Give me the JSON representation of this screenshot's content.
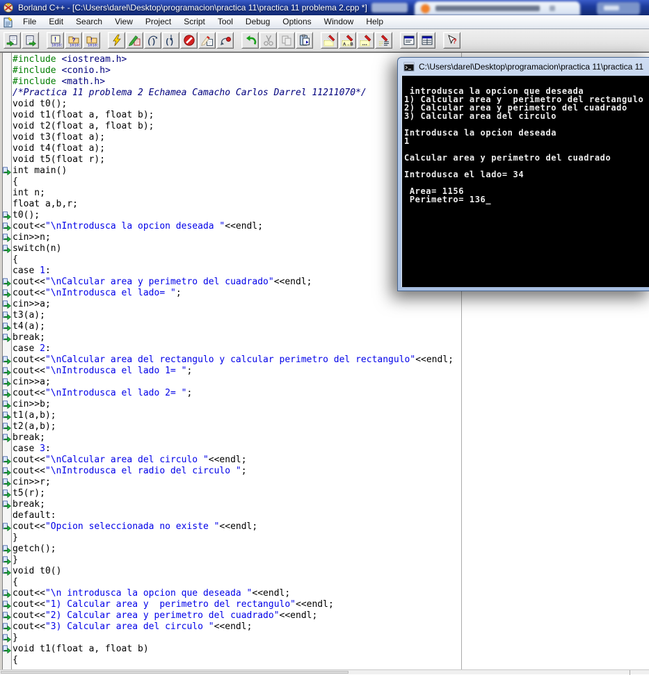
{
  "window": {
    "title": "Borland C++ - [C:\\Users\\darel\\Desktop\\programacion\\practica 11\\practica 11 problema 2.cpp *]"
  },
  "menu": {
    "items": [
      "File",
      "Edit",
      "Search",
      "View",
      "Project",
      "Script",
      "Tool",
      "Debug",
      "Options",
      "Window",
      "Help"
    ]
  },
  "toolbar": {
    "groups": [
      {
        "buttons": [
          {
            "name": "open-file",
            "disabled": false
          },
          {
            "name": "save-file",
            "disabled": false
          }
        ]
      },
      {
        "buttons": [
          {
            "name": "compile-unit",
            "disabled": false
          },
          {
            "name": "make-project",
            "disabled": false
          },
          {
            "name": "build-project",
            "disabled": false
          }
        ]
      },
      {
        "buttons": [
          {
            "name": "run",
            "disabled": false
          },
          {
            "name": "debug-run",
            "disabled": false
          },
          {
            "name": "step-over",
            "disabled": false
          },
          {
            "name": "trace-into",
            "disabled": false
          },
          {
            "name": "program-reset",
            "disabled": false
          },
          {
            "name": "toggle-breakpoint",
            "disabled": false
          },
          {
            "name": "find-execution-point",
            "disabled": false
          }
        ]
      },
      {
        "buttons": [
          {
            "name": "undo",
            "disabled": false
          },
          {
            "name": "cut",
            "disabled": true
          },
          {
            "name": "copy",
            "disabled": true
          },
          {
            "name": "paste",
            "disabled": false
          }
        ]
      },
      {
        "buttons": [
          {
            "name": "search",
            "disabled": false
          },
          {
            "name": "replace",
            "disabled": false
          },
          {
            "name": "search-again",
            "disabled": false
          },
          {
            "name": "browse-symbol",
            "disabled": false
          }
        ]
      },
      {
        "buttons": [
          {
            "name": "message-window",
            "disabled": false
          },
          {
            "name": "project-window",
            "disabled": false
          }
        ]
      },
      {
        "buttons": [
          {
            "name": "context-help",
            "disabled": false
          }
        ]
      }
    ]
  },
  "editor": {
    "lines": [
      {
        "m": 0,
        "seg": [
          [
            "#include",
            "g"
          ],
          [
            " ",
            "p"
          ],
          [
            "<iostream.h>",
            "n"
          ]
        ]
      },
      {
        "m": 0,
        "seg": [
          [
            "#include",
            "g"
          ],
          [
            " ",
            "p"
          ],
          [
            "<conio.h>",
            "n"
          ]
        ]
      },
      {
        "m": 0,
        "seg": [
          [
            "#include",
            "g"
          ],
          [
            " ",
            "p"
          ],
          [
            "<math.h>",
            "n"
          ]
        ]
      },
      {
        "m": 0,
        "seg": [
          [
            "/*Practica 11 problema 2 Echamea Camacho Carlos Darrel 11211070*/",
            "c"
          ]
        ]
      },
      {
        "m": 0,
        "seg": [
          [
            "void t0();",
            "p"
          ]
        ]
      },
      {
        "m": 0,
        "seg": [
          [
            "void t1(float a, float b);",
            "p"
          ]
        ]
      },
      {
        "m": 0,
        "seg": [
          [
            "void t2(float a, float b);",
            "p"
          ]
        ]
      },
      {
        "m": 0,
        "seg": [
          [
            "void t3(float a);",
            "p"
          ]
        ]
      },
      {
        "m": 0,
        "seg": [
          [
            "void t4(float a);",
            "p"
          ]
        ]
      },
      {
        "m": 0,
        "seg": [
          [
            "void t5(float r);",
            "p"
          ]
        ]
      },
      {
        "m": 1,
        "seg": [
          [
            "int main()",
            "p"
          ]
        ]
      },
      {
        "m": 0,
        "seg": [
          [
            "{",
            "p"
          ]
        ]
      },
      {
        "m": 0,
        "seg": [
          [
            "int n;",
            "p"
          ]
        ]
      },
      {
        "m": 0,
        "seg": [
          [
            "float a,b,r;",
            "p"
          ]
        ]
      },
      {
        "m": 1,
        "seg": [
          [
            "t0();",
            "p"
          ]
        ]
      },
      {
        "m": 1,
        "seg": [
          [
            "cout<<",
            "p"
          ],
          [
            "\"\\nIntrodusca la opcion deseada \"",
            "b"
          ],
          [
            "<<endl;",
            "p"
          ]
        ]
      },
      {
        "m": 1,
        "seg": [
          [
            "cin>>n;",
            "p"
          ]
        ]
      },
      {
        "m": 1,
        "seg": [
          [
            "switch(n)",
            "p"
          ]
        ]
      },
      {
        "m": 0,
        "seg": [
          [
            "{",
            "p"
          ]
        ]
      },
      {
        "m": 0,
        "seg": [
          [
            "case ",
            "p"
          ],
          [
            "1",
            "b"
          ],
          [
            ":",
            "p"
          ]
        ]
      },
      {
        "m": 1,
        "seg": [
          [
            "cout<<",
            "p"
          ],
          [
            "\"\\nCalcular area y perimetro del cuadrado\"",
            "b"
          ],
          [
            "<<endl;",
            "p"
          ]
        ]
      },
      {
        "m": 1,
        "seg": [
          [
            "cout<<",
            "p"
          ],
          [
            "\"\\nIntrodusca el lado= \"",
            "b"
          ],
          [
            ";",
            "p"
          ]
        ]
      },
      {
        "m": 1,
        "seg": [
          [
            "cin>>a;",
            "p"
          ]
        ]
      },
      {
        "m": 1,
        "seg": [
          [
            "t3(a);",
            "p"
          ]
        ]
      },
      {
        "m": 1,
        "seg": [
          [
            "t4(a);",
            "p"
          ]
        ]
      },
      {
        "m": 1,
        "seg": [
          [
            "break;",
            "p"
          ]
        ]
      },
      {
        "m": 0,
        "seg": [
          [
            "case ",
            "p"
          ],
          [
            "2",
            "b"
          ],
          [
            ":",
            "p"
          ]
        ]
      },
      {
        "m": 1,
        "seg": [
          [
            "cout<<",
            "p"
          ],
          [
            "\"\\nCalcular area del rectangulo y calcular perimetro del rectangulo\"",
            "b"
          ],
          [
            "<<endl;",
            "p"
          ]
        ]
      },
      {
        "m": 1,
        "seg": [
          [
            "cout<<",
            "p"
          ],
          [
            "\"\\nIntrodusca el lado 1= \"",
            "b"
          ],
          [
            ";",
            "p"
          ]
        ]
      },
      {
        "m": 1,
        "seg": [
          [
            "cin>>a;",
            "p"
          ]
        ]
      },
      {
        "m": 1,
        "seg": [
          [
            "cout<<",
            "p"
          ],
          [
            "\"\\nIntrodusca el lado 2= \"",
            "b"
          ],
          [
            ";",
            "p"
          ]
        ]
      },
      {
        "m": 1,
        "seg": [
          [
            "cin>>b;",
            "p"
          ]
        ]
      },
      {
        "m": 1,
        "seg": [
          [
            "t1(a,b);",
            "p"
          ]
        ]
      },
      {
        "m": 1,
        "seg": [
          [
            "t2(a,b);",
            "p"
          ]
        ]
      },
      {
        "m": 1,
        "seg": [
          [
            "break;",
            "p"
          ]
        ]
      },
      {
        "m": 0,
        "seg": [
          [
            "case ",
            "p"
          ],
          [
            "3",
            "b"
          ],
          [
            ":",
            "p"
          ]
        ]
      },
      {
        "m": 1,
        "seg": [
          [
            "cout<<",
            "p"
          ],
          [
            "\"\\nCalcular area del circulo \"",
            "b"
          ],
          [
            "<<endl;",
            "p"
          ]
        ]
      },
      {
        "m": 1,
        "seg": [
          [
            "cout<<",
            "p"
          ],
          [
            "\"\\nIntrodusca el radio del circulo \"",
            "b"
          ],
          [
            ";",
            "p"
          ]
        ]
      },
      {
        "m": 1,
        "seg": [
          [
            "cin>>r;",
            "p"
          ]
        ]
      },
      {
        "m": 1,
        "seg": [
          [
            "t5(r);",
            "p"
          ]
        ]
      },
      {
        "m": 1,
        "seg": [
          [
            "break;",
            "p"
          ]
        ]
      },
      {
        "m": 0,
        "seg": [
          [
            "default:",
            "p"
          ]
        ]
      },
      {
        "m": 1,
        "seg": [
          [
            "cout<<",
            "p"
          ],
          [
            "\"Opcion seleccionada no existe \"",
            "b"
          ],
          [
            "<<endl;",
            "p"
          ]
        ]
      },
      {
        "m": 0,
        "seg": [
          [
            "}",
            "p"
          ]
        ]
      },
      {
        "m": 1,
        "seg": [
          [
            "getch();",
            "p"
          ]
        ]
      },
      {
        "m": 1,
        "seg": [
          [
            "}",
            "p"
          ]
        ]
      },
      {
        "m": 1,
        "seg": [
          [
            "void t0()",
            "p"
          ]
        ]
      },
      {
        "m": 0,
        "seg": [
          [
            "{",
            "p"
          ]
        ]
      },
      {
        "m": 1,
        "seg": [
          [
            "cout<<",
            "p"
          ],
          [
            "\"\\n introdusca la opcion que deseada \"",
            "b"
          ],
          [
            "<<endl;",
            "p"
          ]
        ]
      },
      {
        "m": 1,
        "seg": [
          [
            "cout<<",
            "p"
          ],
          [
            "\"1) Calcular area y  perimetro del rectangulo\"",
            "b"
          ],
          [
            "<<endl;",
            "p"
          ]
        ]
      },
      {
        "m": 1,
        "seg": [
          [
            "cout<<",
            "p"
          ],
          [
            "\"2) Calcular area y perimetro del cuadrado\"",
            "b"
          ],
          [
            "<<endl;",
            "p"
          ]
        ]
      },
      {
        "m": 1,
        "seg": [
          [
            "cout<<",
            "p"
          ],
          [
            "\"3) Calcular area del circulo \"",
            "b"
          ],
          [
            "<<endl;",
            "p"
          ]
        ]
      },
      {
        "m": 1,
        "seg": [
          [
            "}",
            "p"
          ]
        ]
      },
      {
        "m": 1,
        "seg": [
          [
            "void t1(float a, float b)",
            "p"
          ]
        ]
      },
      {
        "m": 0,
        "seg": [
          [
            "{",
            "p"
          ]
        ]
      }
    ]
  },
  "console": {
    "title": "C:\\Users\\darel\\Desktop\\programacion\\practica 11\\practica 11",
    "lines": [
      "",
      " introdusca la opcion que deseada",
      "1) Calcular area y  perimetro del rectangulo",
      "2) Calcular area y perimetro del cuadrado",
      "3) Calcular area del circulo",
      "",
      "Introdusca la opcion deseada",
      "1",
      "",
      "Calcular area y perimetro del cuadrado",
      "",
      "Introdusca el lado= 34",
      "",
      " Area= 1156",
      " Perimetro= 136_"
    ]
  },
  "colors": {
    "title_bar": "#1e3c9e",
    "preprocessor": "#007d00",
    "include_name": "#00007d",
    "comment": "#00007d",
    "string_number": "#0000e8",
    "console_bg": "#000000",
    "console_fg": "#ececec",
    "aero_frame": "#b3c8e7",
    "gutter_mark": "#1fae3c"
  }
}
